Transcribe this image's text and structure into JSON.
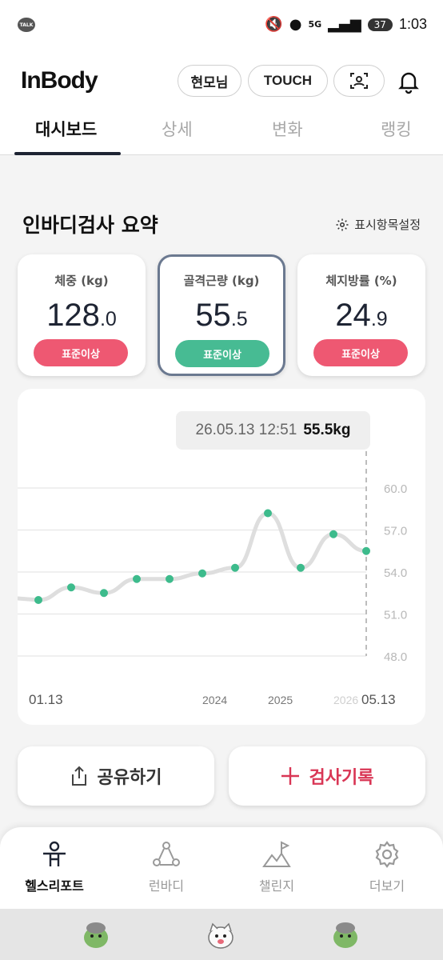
{
  "status": {
    "talk_icon_label": "TALK",
    "network": "5G",
    "battery": "37",
    "time": "1:03"
  },
  "header": {
    "logo": "InBody",
    "user_button": "현모님",
    "touch_button": "TOUCH",
    "tabs": [
      {
        "label": "대시보드",
        "active": true
      },
      {
        "label": "상세",
        "active": false
      },
      {
        "label": "변화",
        "active": false
      },
      {
        "label": "랭킹",
        "active": false
      }
    ]
  },
  "summary": {
    "title": "인바디검사 요약",
    "settings_label": "표시항목설정",
    "cards": [
      {
        "label": "체중 (kg)",
        "value_int": "128",
        "value_dec": ".0",
        "badge": "표준이상",
        "badge_color": "#ee5872"
      },
      {
        "label": "골격근량 (kg)",
        "value_int": "55",
        "value_dec": ".5",
        "badge": "표준이상",
        "badge_color": "#47bb93"
      },
      {
        "label": "체지방률 (%)",
        "value_int": "24",
        "value_dec": ".9",
        "badge": "표준이상",
        "badge_color": "#ee5872"
      }
    ]
  },
  "chart_data": {
    "type": "line",
    "tooltip": {
      "date": "26.05.13 12:51",
      "value": "55.5kg"
    },
    "y_ticks": [
      "60.0",
      "57.0",
      "54.0",
      "51.0",
      "48.0"
    ],
    "ylim": [
      48.0,
      60.0
    ],
    "x_labels": [
      "01.13",
      "2024",
      "2025",
      "2026",
      "05.13"
    ],
    "series": [
      {
        "values": [
          52.0,
          52.9,
          52.5,
          53.5,
          53.5,
          53.9,
          54.3,
          58.2,
          54.3,
          56.7,
          55.5
        ]
      }
    ],
    "point_color": "#3dbb8c",
    "line_color": "#dedede"
  },
  "actions": {
    "share_label": "공유하기",
    "record_label": "검사기록"
  },
  "bottom_nav": [
    {
      "label": "헬스리포트",
      "active": true
    },
    {
      "label": "런바디",
      "active": false
    },
    {
      "label": "챌린지",
      "active": false
    },
    {
      "label": "더보기",
      "active": false
    }
  ]
}
